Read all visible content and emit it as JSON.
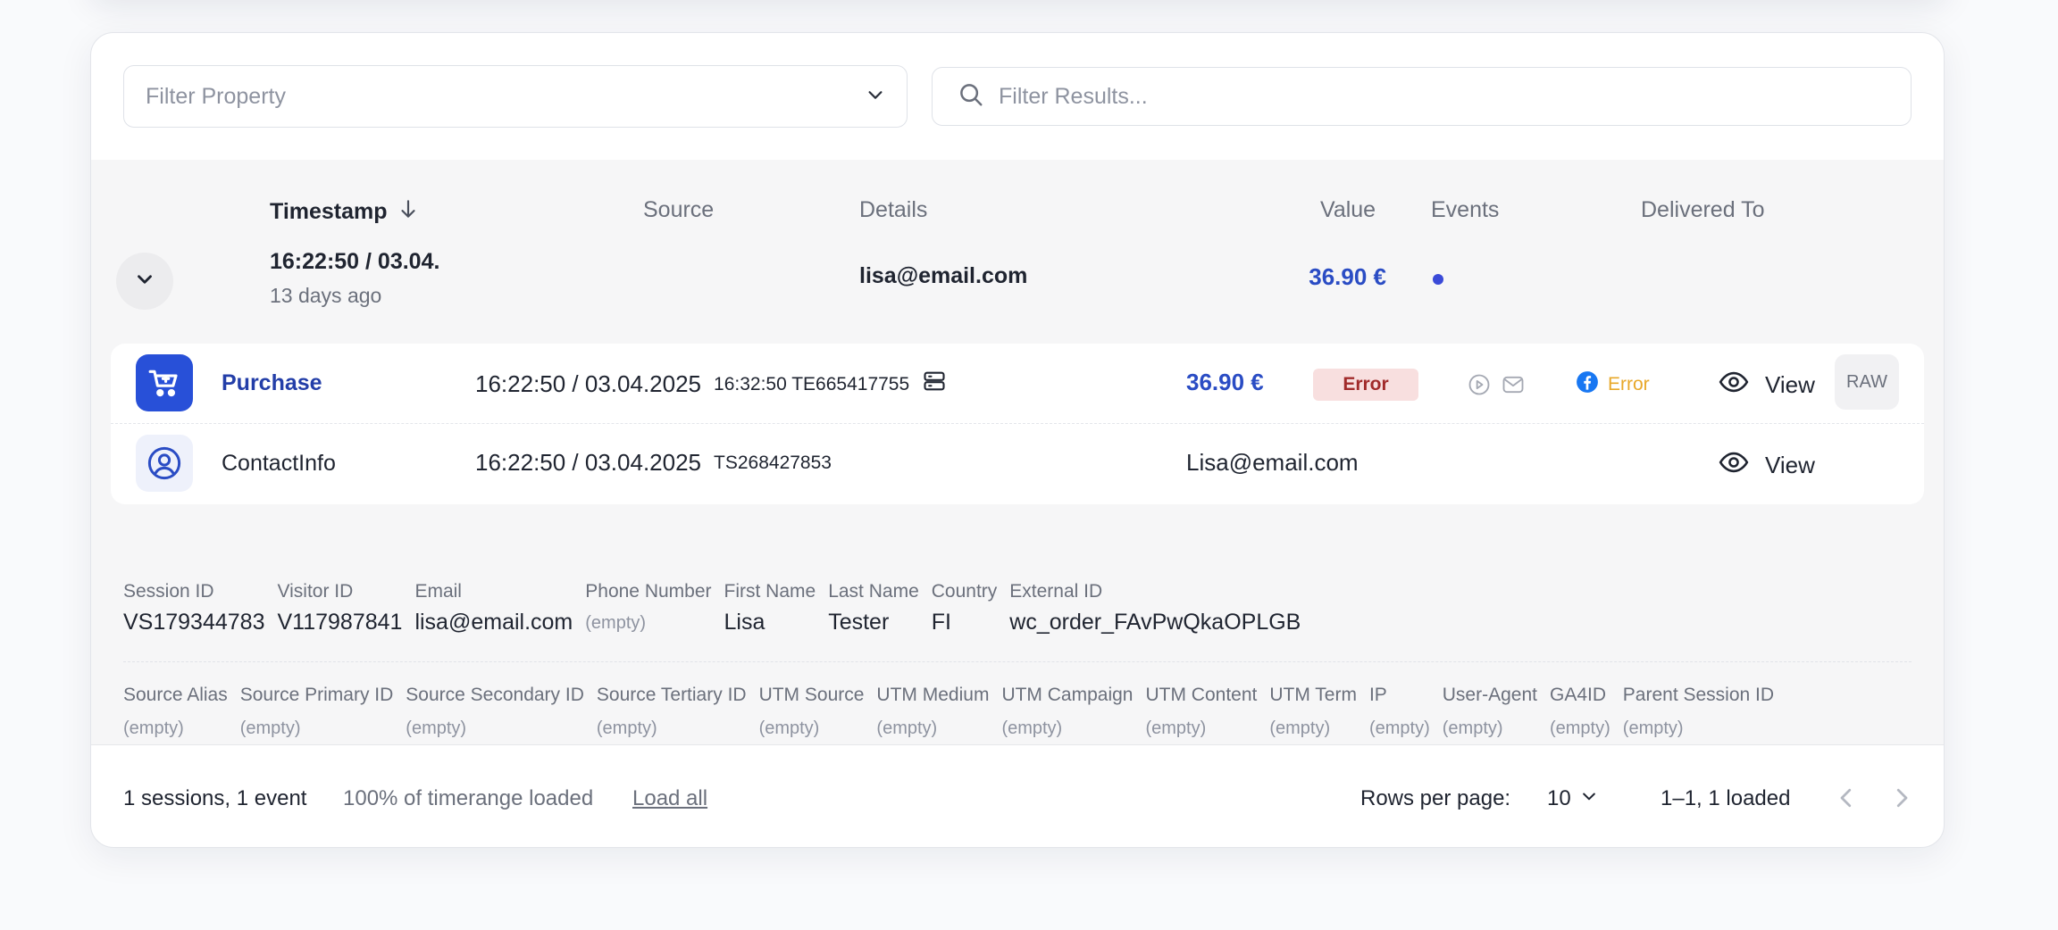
{
  "filters": {
    "property_placeholder": "Filter Property",
    "results_placeholder": "Filter Results..."
  },
  "columns": {
    "timestamp": "Timestamp",
    "source": "Source",
    "details": "Details",
    "value": "Value",
    "events": "Events",
    "delivered_to": "Delivered To"
  },
  "session": {
    "timestamp": "16:22:50 / 03.04.",
    "ago": "13 days ago",
    "email": "lisa@email.com",
    "value": "36.90 €"
  },
  "events": [
    {
      "name": "Purchase",
      "timestamp": "16:22:50 / 03.04.2025",
      "sub": "16:32:50 TE665417755",
      "value": "36.90 €",
      "status": "Error",
      "delivery_status": "Error",
      "view_label": "View",
      "raw_label": "RAW"
    },
    {
      "name": "ContactInfo",
      "timestamp": "16:22:50 / 03.04.2025",
      "sub": "TS268427853",
      "value": "Lisa@email.com",
      "view_label": "View"
    }
  ],
  "properties": [
    {
      "label": "Session ID",
      "value": "VS179344783"
    },
    {
      "label": "Visitor ID",
      "value": "V117987841"
    },
    {
      "label": "Email",
      "value": "lisa@email.com"
    },
    {
      "label": "Phone Number",
      "value": "(empty)"
    },
    {
      "label": "First Name",
      "value": "Lisa"
    },
    {
      "label": "Last Name",
      "value": "Tester"
    },
    {
      "label": "Country",
      "value": "FI"
    },
    {
      "label": "External ID",
      "value": "wc_order_FAvPwQkaOPLGB"
    }
  ],
  "source_properties": [
    {
      "label": "Source Alias",
      "value": "(empty)"
    },
    {
      "label": "Source Primary ID",
      "value": "(empty)"
    },
    {
      "label": "Source Secondary ID",
      "value": "(empty)"
    },
    {
      "label": "Source Tertiary ID",
      "value": "(empty)"
    },
    {
      "label": "UTM Source",
      "value": "(empty)"
    },
    {
      "label": "UTM Medium",
      "value": "(empty)"
    },
    {
      "label": "UTM Campaign",
      "value": "(empty)"
    },
    {
      "label": "UTM Content",
      "value": "(empty)"
    },
    {
      "label": "UTM Term",
      "value": "(empty)"
    },
    {
      "label": "IP",
      "value": "(empty)"
    },
    {
      "label": "User-Agent",
      "value": "(empty)"
    },
    {
      "label": "GA4ID",
      "value": "(empty)"
    },
    {
      "label": "Parent Session ID",
      "value": "(empty)"
    }
  ],
  "footer": {
    "summary": "1 sessions, 1 event",
    "loaded": "100% of timerange loaded",
    "load_all": "Load all",
    "rows_per_page_label": "Rows per page:",
    "rows_per_page": "10",
    "range": "1–1, 1 loaded"
  },
  "colors": {
    "accent": "#2a4cc4",
    "error_bg": "#f8dfdf",
    "error_text": "#a12b2b",
    "warning": "#e8a82a",
    "facebook": "#1877f2"
  },
  "icons": {
    "dropdown": "chevron-down-icon",
    "search": "search-icon",
    "sort": "arrow-down-icon",
    "expand": "chevron-down-icon",
    "purchase": "cart-icon",
    "contact": "user-circle-icon",
    "server": "server-icon",
    "play": "play-icon",
    "mail": "mail-icon",
    "facebook": "facebook-icon",
    "view": "eye-icon",
    "prev": "chevron-left-icon",
    "next": "chevron-right-icon"
  }
}
